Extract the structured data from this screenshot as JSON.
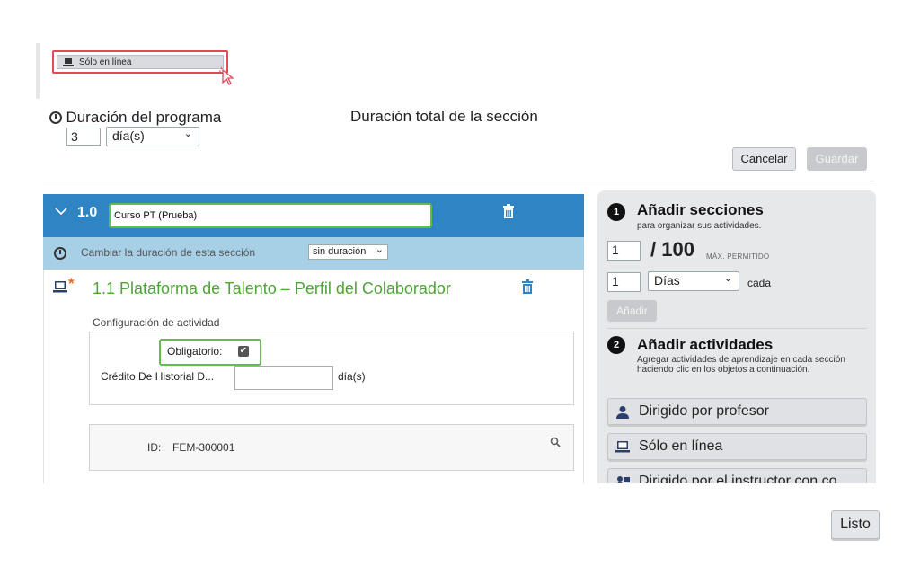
{
  "thumbnail": {
    "label": "Sólo en línea"
  },
  "program": {
    "duration_label": "Duración del programa",
    "duration_value": "3",
    "duration_unit": "día(s)",
    "total_label": "Duración total de la sección"
  },
  "toolbar": {
    "cancel": "Cancelar",
    "save": "Guardar"
  },
  "section": {
    "number": "1.0",
    "name": "Curso PT (Prueba)",
    "change_duration_label": "Cambiar la duración de esta sección",
    "duration_option": "sin duración"
  },
  "activity": {
    "title": "1.1 Plataforma de Talento – Perfil del Colaborador",
    "config_label": "Configuración de actividad",
    "required_label": "Obligatorio:",
    "required_checked": true,
    "credit_label": "Crédito De Historial D...",
    "credit_unit": "día(s)",
    "id_label": "ID:",
    "id_value": "FEM-300001"
  },
  "add_sections": {
    "step": "1",
    "title": "Añadir secciones",
    "desc": "para organizar sus actividades.",
    "count_value": "1",
    "max_value": "/ 100",
    "max_label": "MÁX. PERMITIDO",
    "interval_value": "1",
    "interval_unit": "Días",
    "interval_suffix": "cada",
    "add_button": "Añadir"
  },
  "add_activities": {
    "step": "2",
    "title": "Añadir actividades",
    "desc": "Agregar actividades de aprendizaje en cada sección haciendo clic en los objetos a continuación.",
    "items": [
      {
        "label": "Dirigido por profesor",
        "icon": "person-icon"
      },
      {
        "label": "Sólo en línea",
        "icon": "laptop-icon"
      },
      {
        "label": "Dirigido por el instructor con co",
        "icon": "instructor-icon"
      }
    ]
  },
  "footer": {
    "done": "Listo"
  },
  "colors": {
    "section_header": "#2f84c4",
    "section_sub": "#a7cfe6",
    "activity_title": "#4ea437",
    "highlight_green": "#5fbf4b",
    "highlight_red": "#e04b57"
  }
}
